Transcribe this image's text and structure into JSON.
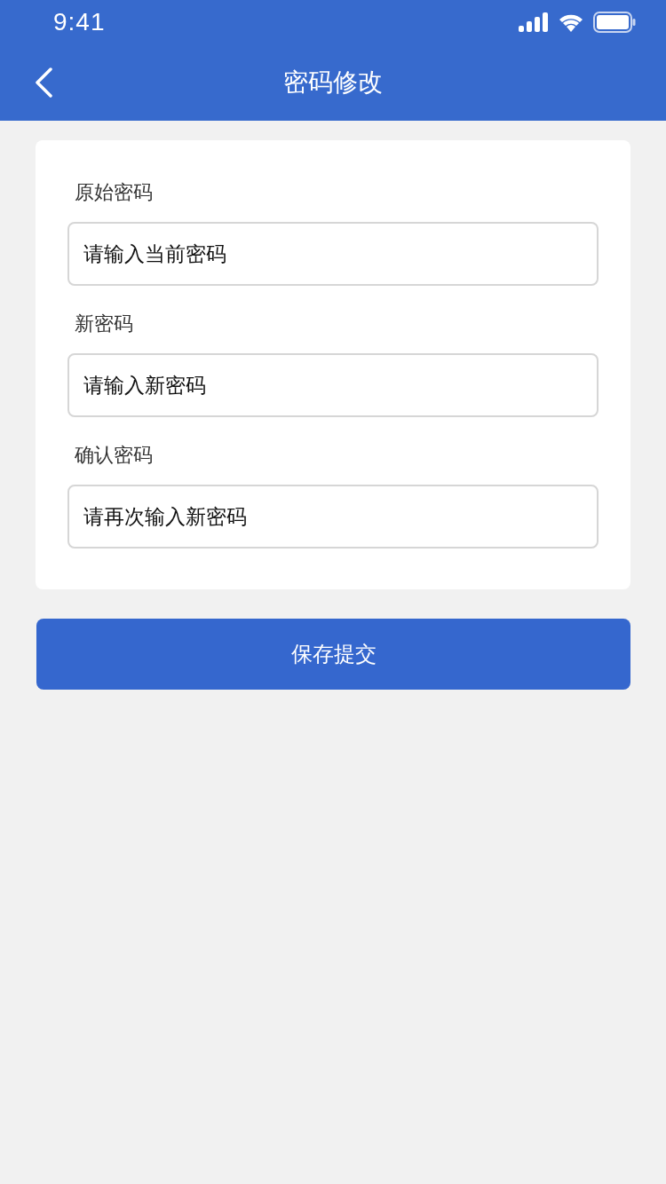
{
  "status_bar": {
    "time": "9:41"
  },
  "nav": {
    "title": "密码修改"
  },
  "fields": [
    {
      "label": "原始密码",
      "placeholder": "请输入当前密码"
    },
    {
      "label": "新密码",
      "placeholder": "请输入新密码"
    },
    {
      "label": "确认密码",
      "placeholder": "请再次输入新密码"
    }
  ],
  "submit": "保存提交"
}
